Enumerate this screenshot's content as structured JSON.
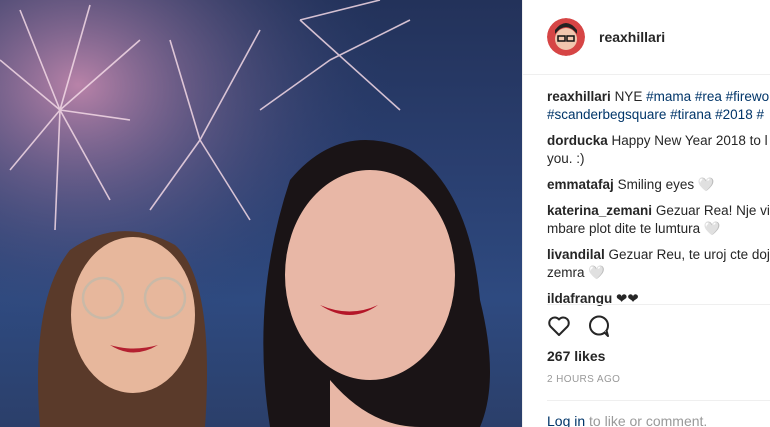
{
  "post": {
    "username": "reaxhillari",
    "caption_user": "reaxhillari",
    "caption_text": "NYE",
    "hashtags_line1": [
      "#mama",
      "#rea",
      "#firewo"
    ],
    "hashtags_line2": [
      "#scanderbegsquare",
      "#tirana",
      "#2018",
      "#"
    ]
  },
  "comments": [
    {
      "user": "dorducka",
      "text": "Happy New Year 2018 to l you. :)"
    },
    {
      "user": "emmatafaj",
      "text": "Smiling eyes 🤍"
    },
    {
      "user": "katerina_zemani",
      "text": "Gezuar Rea! Nje vit mbare plot dite te lumtura 🤍"
    },
    {
      "user": "livandilal",
      "text": "Gezuar Reu, te uroj cte doj zemra 🤍"
    },
    {
      "user": "ildafrangu",
      "text": "❤❤"
    }
  ],
  "likes": "267 likes",
  "timestamp": "2 HOURS AGO",
  "login": {
    "link": "Log in",
    "rest": "to like or comment."
  },
  "icons": {
    "like": "heart-outline-icon",
    "comment": "comment-bubble-icon"
  }
}
